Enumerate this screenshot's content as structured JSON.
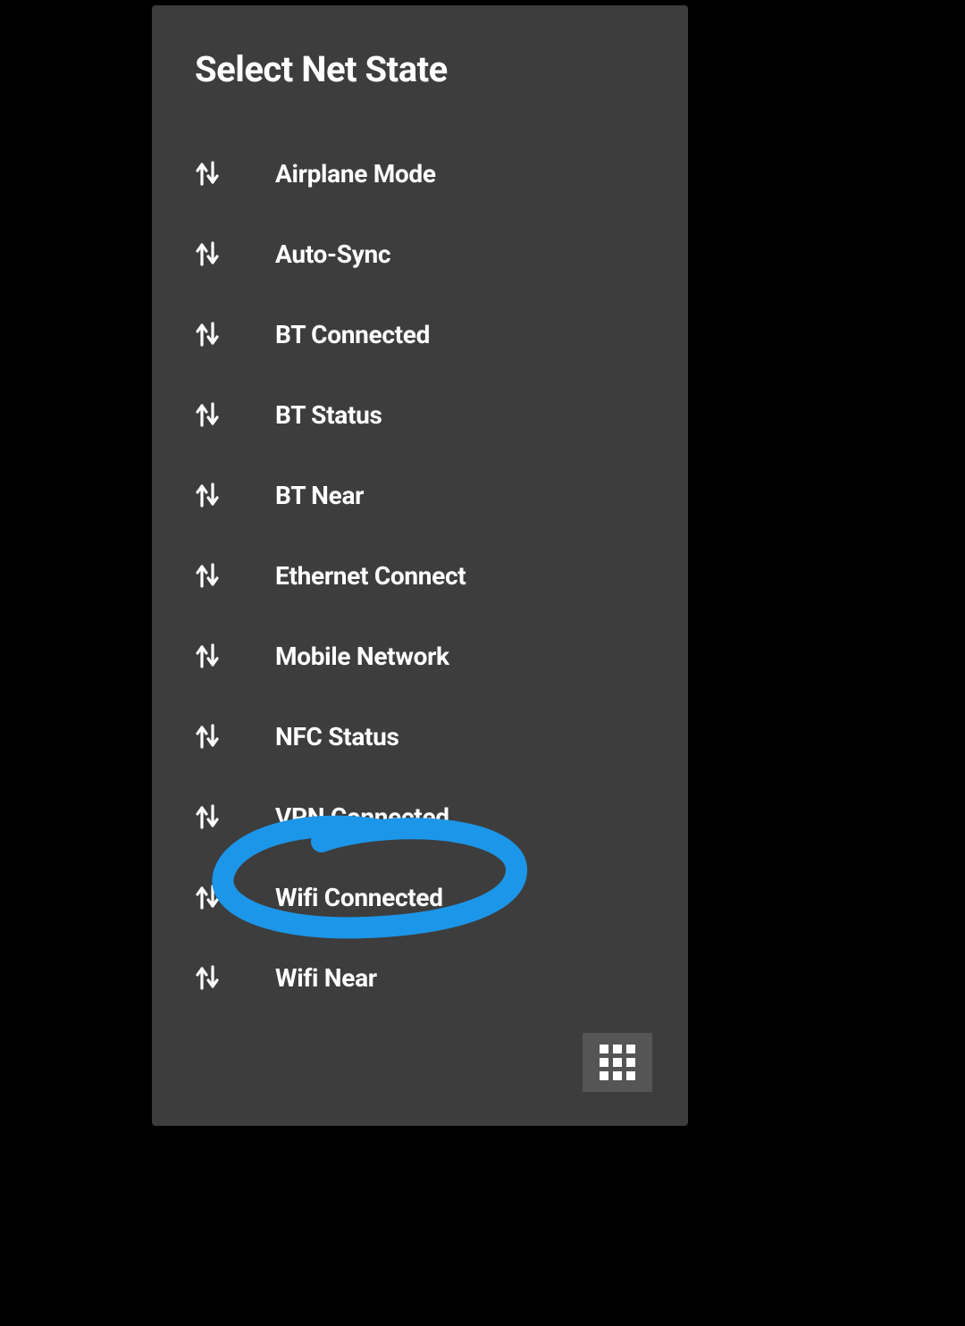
{
  "panel": {
    "title": "Select Net State",
    "items": [
      {
        "label": "Airplane Mode"
      },
      {
        "label": "Auto-Sync"
      },
      {
        "label": "BT Connected"
      },
      {
        "label": "BT Status"
      },
      {
        "label": "BT Near"
      },
      {
        "label": "Ethernet Connect"
      },
      {
        "label": "Mobile Network"
      },
      {
        "label": "NFC Status"
      },
      {
        "label": "VPN Connected"
      },
      {
        "label": "Wifi Connected"
      },
      {
        "label": "Wifi Near"
      }
    ]
  },
  "annotation": {
    "color": "#1c96e8",
    "highlighted_index": 9
  }
}
